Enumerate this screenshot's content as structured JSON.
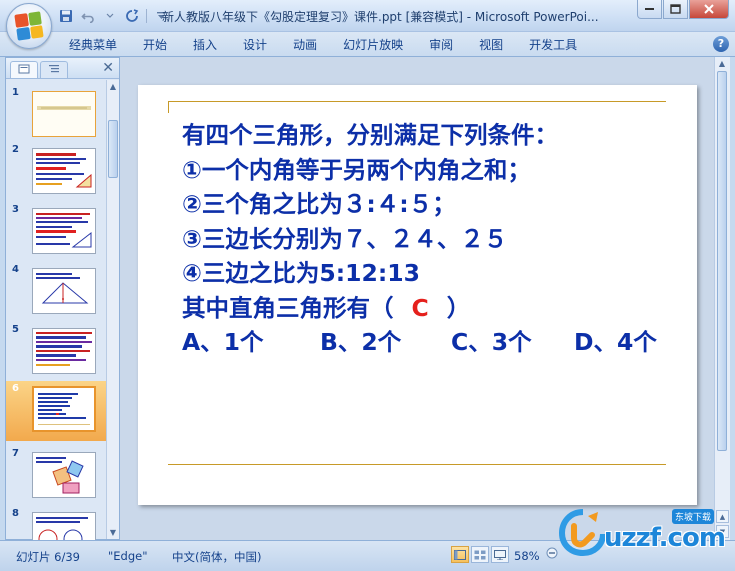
{
  "window": {
    "title": "新人教版八年级下《勾股定理复习》课件.ppt [兼容模式] - Microsoft PowerPoi..."
  },
  "ribbon": {
    "tabs": [
      "经典菜单",
      "开始",
      "插入",
      "设计",
      "动画",
      "幻灯片放映",
      "审阅",
      "视图",
      "开发工具"
    ]
  },
  "slide_pane": {
    "thumbnails": [
      {
        "num": "1",
        "selected": false
      },
      {
        "num": "2",
        "selected": false
      },
      {
        "num": "3",
        "selected": false
      },
      {
        "num": "4",
        "selected": false
      },
      {
        "num": "5",
        "selected": false
      },
      {
        "num": "6",
        "selected": true
      },
      {
        "num": "7",
        "selected": false
      },
      {
        "num": "8",
        "selected": false
      }
    ]
  },
  "slide": {
    "lines": [
      "有四个三角形，分别满足下列条件：",
      "①一个内角等于另两个内角之和；",
      "②三个角之比为３:４:５；",
      "③三边长分别为７、２４、２５",
      "④三边之比为5:12:13"
    ],
    "question_prefix": "其中直角三角形有（",
    "question_answer": "C",
    "question_suffix": "）",
    "options": [
      "A、1个",
      "B、2个",
      "C、3个",
      "D、4个"
    ]
  },
  "status_bar": {
    "slide_info": "幻灯片 6/39",
    "theme": "\"Edge\"",
    "language": "中文(简体，中国)",
    "zoom": "58%"
  },
  "watermark": {
    "text": "uzzf.com",
    "badge": "东坡下载"
  },
  "colors": {
    "slide_text": "#0c2fa8",
    "answer": "#e5201c",
    "rule": "#c79a28",
    "selected_thumb": "#f2a94d"
  }
}
